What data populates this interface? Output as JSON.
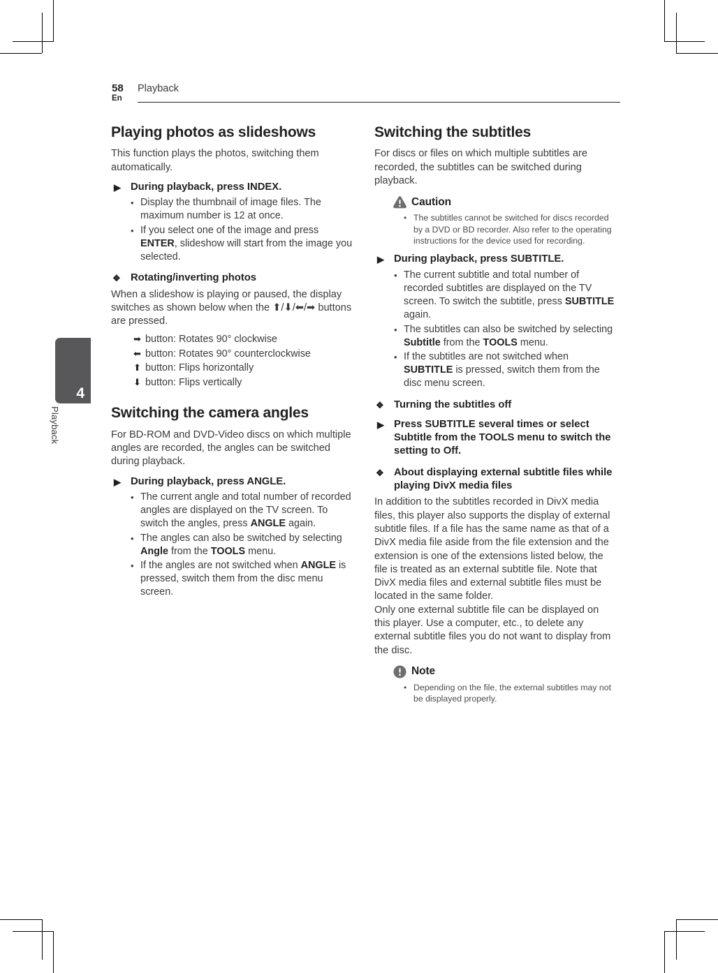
{
  "page": {
    "number": "58",
    "language": "En",
    "chapter_header": "Playback",
    "tab_number": "4",
    "tab_label": "Playback"
  },
  "left_column": {
    "section1": {
      "title": "Playing photos as slideshows",
      "intro": "This function plays the photos, switching them automatically.",
      "step": {
        "marker": "▶",
        "text": "During playback, press INDEX."
      },
      "bullets": [
        "Display the thumbnail of image files. The maximum number is 12 at once.",
        "If you select one of the image and press ENTER, slideshow will start from the image you selected."
      ],
      "subhead": {
        "marker": "❖",
        "text": "Rotating/inverting photos"
      },
      "subhead_body": "When a slideshow is playing or paused, the display switches as shown below when the ⬆/⬇/⬅/➡ buttons are pressed.",
      "keylist": [
        {
          "arrow": "➡",
          "text": "button: Rotates 90° clockwise"
        },
        {
          "arrow": "⬅",
          "text": "button: Rotates 90° counterclockwise"
        },
        {
          "arrow": "⬆",
          "text": "button: Flips horizontally"
        },
        {
          "arrow": "⬇",
          "text": "button: Flips vertically"
        }
      ]
    },
    "section2": {
      "title": "Switching the camera angles",
      "intro": "For BD-ROM and DVD-Video discs on which multiple angles are recorded, the angles can be switched during playback.",
      "step": {
        "marker": "▶",
        "text": "During playback, press ANGLE."
      },
      "bullets": [
        "The current angle and total number of recorded angles are displayed on the TV screen. To switch the angles, press ANGLE again.",
        "The angles can also be switched by selecting Angle from the TOOLS menu.",
        "If the angles are not switched when ANGLE is pressed, switch them from the disc menu screen."
      ]
    }
  },
  "right_column": {
    "section1": {
      "title": "Switching the subtitles",
      "intro": "For discs or files on which multiple subtitles are recorded, the subtitles can be switched during playback.",
      "caution": {
        "icon": "caution-triangle-icon",
        "label": "Caution",
        "bullets": [
          "The subtitles cannot be switched for discs recorded by a DVD or BD recorder. Also refer to the operating instructions for the device used for recording."
        ]
      },
      "step": {
        "marker": "▶",
        "text": "During playback, press SUBTITLE."
      },
      "bullets": [
        "The current subtitle and total number of recorded subtitles are displayed on the TV screen. To switch the subtitle, press SUBTITLE again.",
        "The subtitles can also be switched by selecting Subtitle from the TOOLS menu.",
        "If the subtitles are not switched when SUBTITLE is pressed, switch them from the disc menu screen."
      ],
      "subhead_off": {
        "marker": "❖",
        "text": "Turning the subtitles off"
      },
      "step_off": {
        "marker": "▶",
        "text": "Press SUBTITLE several times or select Subtitle from the TOOLS menu to switch the setting to Off."
      },
      "subhead_divx": {
        "marker": "❖",
        "text": "About displaying external subtitle files while playing DivX media files"
      },
      "divx_body_1": "In addition to the subtitles recorded in DivX media files, this player also supports the display of external subtitle files. If a file has the same name as that of a DivX media file aside from the file extension and the extension is one of the extensions listed below, the file is treated as an external subtitle file. Note that DivX media files and external subtitle files must be located in the same folder.",
      "divx_body_2": "Only one external subtitle file can be displayed on this player. Use a computer, etc., to delete any external subtitle files you do not want to display from the disc.",
      "note": {
        "icon": "note-circle-icon",
        "label": "Note",
        "bullets": [
          "Depending on the file, the external subtitles may not be displayed properly."
        ]
      }
    }
  },
  "colors": {
    "tab_background": "#58585a",
    "body_text": "#3b3b3b",
    "heading_text": "#231f20",
    "icon_gray": "#6d6e70"
  }
}
